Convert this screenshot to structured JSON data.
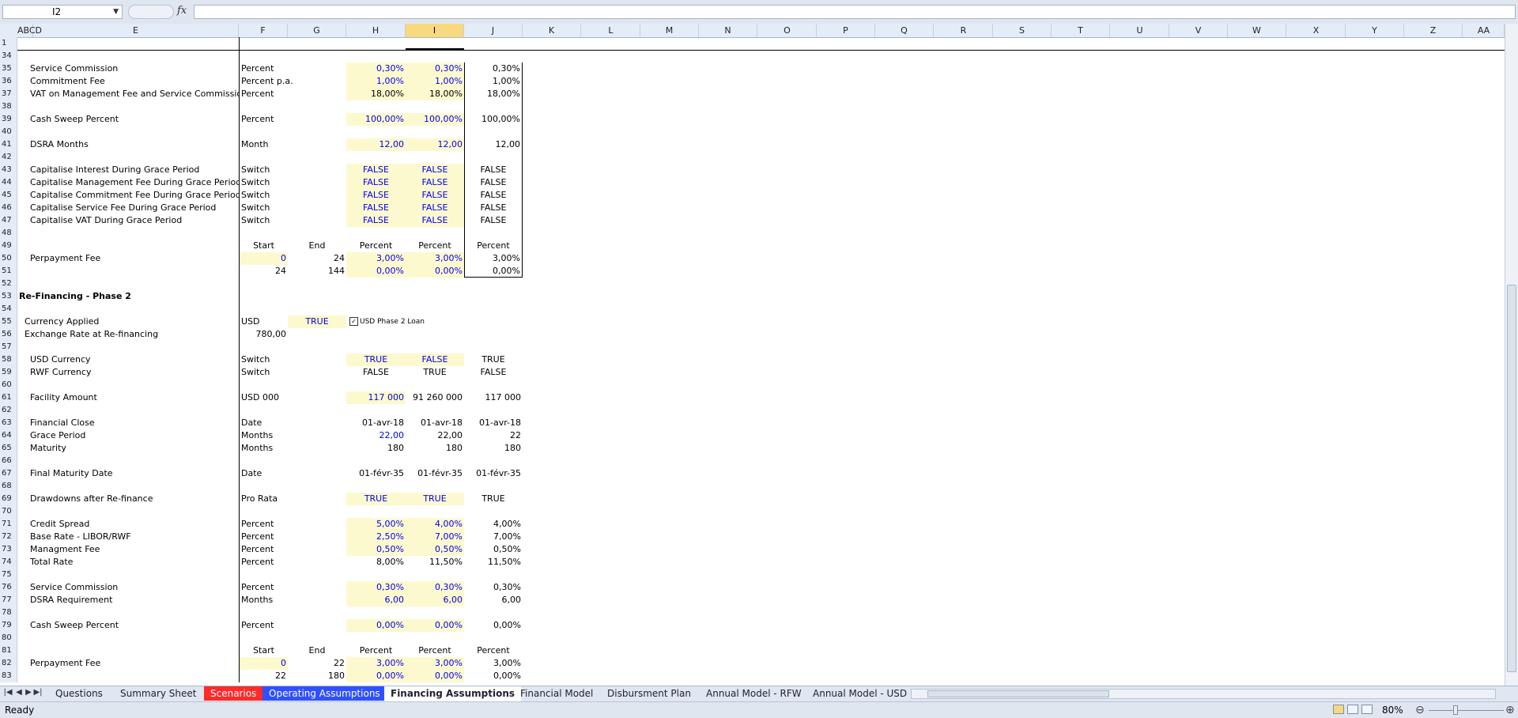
{
  "formula_bar": {
    "name_box": "I2",
    "fx_label": "fx",
    "formula": ""
  },
  "columns": [
    "A",
    "B",
    "C",
    "D",
    "E",
    "F",
    "G",
    "H",
    "I",
    "J",
    "K",
    "L",
    "M",
    "N",
    "O",
    "P",
    "Q",
    "R",
    "S",
    "T",
    "U",
    "V",
    "W",
    "X",
    "Y",
    "Z",
    "AA"
  ],
  "selected_column": "I",
  "rows": [
    {
      "n": "1"
    },
    {
      "n": "34"
    },
    {
      "n": "35",
      "label": "Service Commission",
      "F": "Percent",
      "H": "0,30%",
      "I": "0,30%",
      "J": "0,30%",
      "hy": true,
      "iy": true,
      "blue": true
    },
    {
      "n": "36",
      "label": "Commitment Fee",
      "F": "Percent p.a.",
      "H": "1,00%",
      "I": "1,00%",
      "J": "1,00%",
      "hy": true,
      "iy": true,
      "blue": true
    },
    {
      "n": "37",
      "label": "VAT on Management Fee and Service Commission",
      "F": "Percent",
      "H": "18,00%",
      "I": "18,00%",
      "J": "18,00%",
      "hy": true,
      "iy": true
    },
    {
      "n": "38"
    },
    {
      "n": "39",
      "label": "Cash Sweep Percent",
      "F": "Percent",
      "H": "100,00%",
      "I": "100,00%",
      "J": "100,00%",
      "hy": true,
      "iy": true,
      "blue": true
    },
    {
      "n": "40"
    },
    {
      "n": "41",
      "label": "DSRA Months",
      "F": "Month",
      "H": "12,00",
      "I": "12,00",
      "J": "12,00",
      "hy": true,
      "iy": true,
      "blue": true
    },
    {
      "n": "42"
    },
    {
      "n": "43",
      "label": "Capitalise Interest During Grace Period",
      "F": "Switch",
      "H": "FALSE",
      "I": "FALSE",
      "J": "FALSE",
      "hy": true,
      "iy": true,
      "blue": true,
      "center": true
    },
    {
      "n": "44",
      "label": "Capitalise Management Fee During Grace Period",
      "F": "Switch",
      "H": "FALSE",
      "I": "FALSE",
      "J": "FALSE",
      "hy": true,
      "iy": true,
      "blue": true,
      "center": true
    },
    {
      "n": "45",
      "label": "Capitalise Commitment Fee During Grace Period",
      "F": "Switch",
      "H": "FALSE",
      "I": "FALSE",
      "J": "FALSE",
      "hy": true,
      "iy": true,
      "blue": true,
      "center": true
    },
    {
      "n": "46",
      "label": "Capitalise Service Fee During Grace Period",
      "F": "Switch",
      "H": "FALSE",
      "I": "FALSE",
      "J": "FALSE",
      "hy": true,
      "iy": true,
      "blue": true,
      "center": true
    },
    {
      "n": "47",
      "label": "Capitalise VAT During Grace Period",
      "F": "Switch",
      "H": "FALSE",
      "I": "FALSE",
      "J": "FALSE",
      "hy": true,
      "iy": true,
      "blue": true,
      "center": true
    },
    {
      "n": "48"
    },
    {
      "n": "49",
      "F": "Start",
      "G": "End",
      "H": "Percent",
      "I": "Percent",
      "J": "Percent",
      "center": true,
      "fcenter": true
    },
    {
      "n": "50",
      "label": "Perpayment Fee",
      "F": "0",
      "G": "24",
      "H": "3,00%",
      "I": "3,00%",
      "J": "3,00%",
      "fy": true,
      "hy": true,
      "iy": true,
      "blue": true,
      "fr": true
    },
    {
      "n": "51",
      "F": "24",
      "G": "144",
      "H": "0,00%",
      "I": "0,00%",
      "J": "0,00%",
      "hy": true,
      "iy": true,
      "blue": true,
      "fr": true
    },
    {
      "n": "52"
    },
    {
      "n": "53",
      "section": "Re-Financing - Phase 2"
    },
    {
      "n": "54"
    },
    {
      "n": "55",
      "label2": "Currency Applied",
      "F": "USD",
      "G": "TRUE",
      "gy": true,
      "checkbox": "USD Phase 2 Loan"
    },
    {
      "n": "56",
      "label2": "Exchange Rate at Re-financing",
      "F": "780,00",
      "fr": true
    },
    {
      "n": "57"
    },
    {
      "n": "58",
      "label": "USD Currency",
      "F": "Switch",
      "H": "TRUE",
      "I": "FALSE",
      "J": "TRUE",
      "hy": true,
      "iy": true,
      "blue": true,
      "center": true
    },
    {
      "n": "59",
      "label": "RWF Currency",
      "F": "Switch",
      "H": "FALSE",
      "I": "TRUE",
      "J": "FALSE",
      "center": true
    },
    {
      "n": "60"
    },
    {
      "n": "61",
      "label": "Facility Amount",
      "F": "USD 000",
      "H": "117 000",
      "I": "91 260 000",
      "J": "117 000",
      "hy": true,
      "blue": true
    },
    {
      "n": "62"
    },
    {
      "n": "63",
      "label": "Financial Close",
      "F": "Date",
      "H": "01-avr-18",
      "I": "01-avr-18",
      "J": "01-avr-18"
    },
    {
      "n": "64",
      "label": "Grace Period",
      "F": "Months",
      "H": "22,00",
      "I": "22,00",
      "J": "22",
      "blue": true
    },
    {
      "n": "65",
      "label": "Maturity",
      "F": "Months",
      "H": "180",
      "I": "180",
      "J": "180"
    },
    {
      "n": "66"
    },
    {
      "n": "67",
      "label": "Final Maturity Date",
      "F": "Date",
      "H": "01-févr-35",
      "I": "01-févr-35",
      "J": "01-févr-35"
    },
    {
      "n": "68"
    },
    {
      "n": "69",
      "label": "Drawdowns after Re-finance",
      "F": "Pro Rata",
      "H": "TRUE",
      "I": "TRUE",
      "J": "TRUE",
      "hy": true,
      "iy": true,
      "blue": true,
      "center": true
    },
    {
      "n": "70"
    },
    {
      "n": "71",
      "label": "Credit Spread",
      "F": "Percent",
      "H": "5,00%",
      "I": "4,00%",
      "J": "4,00%",
      "hy": true,
      "iy": true,
      "blue": true
    },
    {
      "n": "72",
      "label": "Base Rate - LIBOR/RWF",
      "F": "Percent",
      "H": "2,50%",
      "I": "7,00%",
      "J": "7,00%",
      "hy": true,
      "iy": true,
      "blue": true
    },
    {
      "n": "73",
      "label": "Managment Fee",
      "F": "Percent",
      "H": "0,50%",
      "I": "0,50%",
      "J": "0,50%",
      "hy": true,
      "iy": true,
      "blue": true
    },
    {
      "n": "74",
      "label": "Total Rate",
      "F": "Percent",
      "H": "8,00%",
      "I": "11,50%",
      "J": "11,50%"
    },
    {
      "n": "75"
    },
    {
      "n": "76",
      "label": "Service Commission",
      "F": "Percent",
      "H": "0,30%",
      "I": "0,30%",
      "J": "0,30%",
      "hy": true,
      "iy": true,
      "blue": true
    },
    {
      "n": "77",
      "label": "DSRA Requirement",
      "F": "Months",
      "H": "6,00",
      "I": "6,00",
      "J": "6,00",
      "hy": true,
      "iy": true,
      "blue": true
    },
    {
      "n": "78"
    },
    {
      "n": "79",
      "label": "Cash Sweep Percent",
      "F": "Percent",
      "H": "0,00%",
      "I": "0,00%",
      "J": "0,00%",
      "hy": true,
      "iy": true,
      "blue": true
    },
    {
      "n": "80"
    },
    {
      "n": "81",
      "F": "Start",
      "G": "End",
      "H": "Percent",
      "I": "Percent",
      "J": "Percent",
      "center": true,
      "fcenter": true
    },
    {
      "n": "82",
      "label": "Perpayment Fee",
      "F": "0",
      "G": "22",
      "H": "3,00%",
      "I": "3,00%",
      "J": "3,00%",
      "fy": true,
      "hy": true,
      "iy": true,
      "blue": true,
      "fr": true
    },
    {
      "n": "83",
      "F": "22",
      "G": "180",
      "H": "0,00%",
      "I": "0,00%",
      "J": "0,00%",
      "hy": true,
      "iy": true,
      "blue": true,
      "fr": true
    }
  ],
  "sheet_tabs": [
    {
      "label": "Questions",
      "style": "normal"
    },
    {
      "label": "Summary Sheet",
      "style": "normal"
    },
    {
      "label": "Scenarios",
      "style": "red"
    },
    {
      "label": "Operating Assumptions",
      "style": "blue"
    },
    {
      "label": "Financing Assumptions",
      "style": "active"
    },
    {
      "label": "Financial Model",
      "style": "normal"
    },
    {
      "label": "Disbursment Plan",
      "style": "normal"
    },
    {
      "label": "Annual Model - RFW",
      "style": "normal"
    },
    {
      "label": "Annual Model - USD",
      "style": "normal"
    }
  ],
  "status": {
    "text": "Ready",
    "zoom": "80%"
  },
  "colors": {
    "input_fill": "#fdf9cf",
    "input_text": "#0000ee",
    "selected_header": "#f8d97e"
  }
}
